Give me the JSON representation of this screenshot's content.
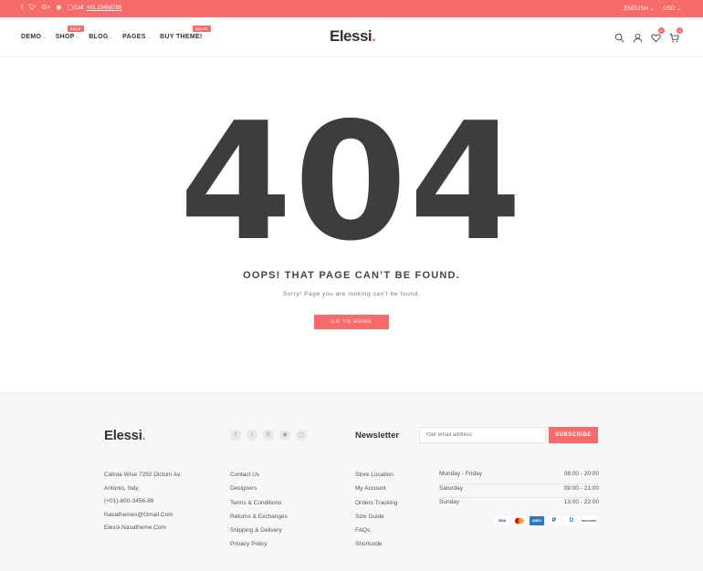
{
  "topbar": {
    "call_label": "Call:",
    "phone": "+01 23456789",
    "language": "ENGLISH",
    "currency": "USD",
    "social_icons": [
      "facebook-icon",
      "twitter-icon",
      "google-plus-icon",
      "pinterest-icon",
      "instagram-icon"
    ]
  },
  "nav": {
    "demo": "DEMO",
    "shop": "SHOP",
    "shop_badge": "SALE",
    "blog": "BLOG",
    "pages": "PAGES",
    "buy": "BUY THEME!",
    "buy_badge": "SALE!"
  },
  "logo": {
    "text": "Elessi",
    "dot": "."
  },
  "header_icons": {
    "wishlist_count": "0",
    "cart_count": "0"
  },
  "main": {
    "code": "404",
    "title": "OOPS! THAT PAGE CAN’T BE FOUND.",
    "subtitle": "Sorry! Page you are looking can’t be found.",
    "button": "GO TO HOME"
  },
  "footer": {
    "logo": "Elessi",
    "logo_dot": ".",
    "newsletter_title": "Newsletter",
    "newsletter_placeholder": "Your email address",
    "subscribe": "SUBSCRIBE",
    "contact": [
      "Calista Wise 7292 Dictum Av.",
      "Antonio, Italy.",
      "(+01)-800-3456-88",
      "Nasathemes@Gmail.Com",
      "Elessi.Nasatheme.Com"
    ],
    "links1": [
      "Contact Us",
      "Designers",
      "Terms & Conditions",
      "Returns & Exchanges",
      "Shipping & Delivery",
      "Privacy Policy"
    ],
    "links2": [
      "Store Location",
      "My Account",
      "Orders Tracking",
      "Size Guide",
      "FAQs",
      "Shortcode"
    ],
    "hours": [
      {
        "day": "Monday - Friday",
        "time": "08:00 - 20:00"
      },
      {
        "day": "Saturday",
        "time": "09:00 - 21:00"
      },
      {
        "day": "Sunday",
        "time": "13:00 - 22:00"
      }
    ],
    "payments": [
      "VISA",
      "MC",
      "AMEX",
      "P",
      "D",
      "DISCOVER"
    ]
  },
  "colors": {
    "accent": "#f76b6a",
    "text_dark": "#3d3d3d"
  }
}
